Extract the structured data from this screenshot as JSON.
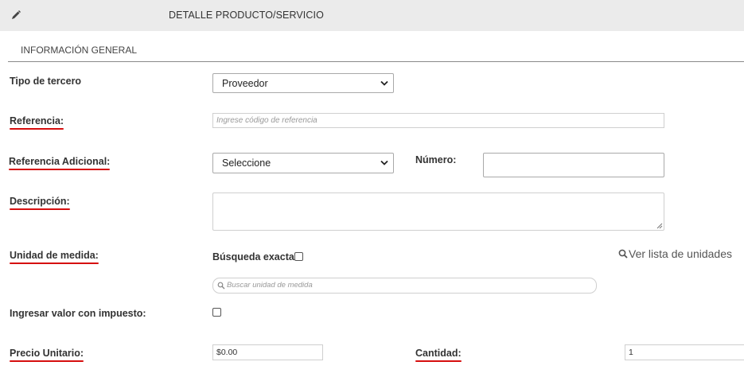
{
  "header": {
    "title": "DETALLE PRODUCTO/SERVICIO",
    "icon": "pencil-icon"
  },
  "section": {
    "title": "INFORMACIÓN GENERAL"
  },
  "form": {
    "tipo_tercero": {
      "label": "Tipo de tercero",
      "value": "Proveedor"
    },
    "referencia": {
      "label": "Referencia:",
      "placeholder": "Ingrese código de referencia"
    },
    "referencia_adicional": {
      "label": "Referencia Adicional:",
      "value": "Seleccione"
    },
    "numero": {
      "label": "Número:",
      "value": ""
    },
    "descripcion": {
      "label": "Descripción:",
      "value": ""
    },
    "unidad_medida": {
      "label": "Unidad de medida:",
      "exact_label": "Búsqueda exacta:",
      "search_placeholder": "Buscar unidad de medida",
      "link_label": "Ver lista de unidades"
    },
    "valor_impuesto": {
      "label": "Ingresar valor con impuesto:"
    },
    "precio_unitario": {
      "label": "Precio Unitario:",
      "value": "$0.00"
    },
    "cantidad": {
      "label": "Cantidad:",
      "value": "1"
    }
  },
  "colors": {
    "required_underline": "#d60f0f",
    "header_bg": "#ebebeb"
  }
}
